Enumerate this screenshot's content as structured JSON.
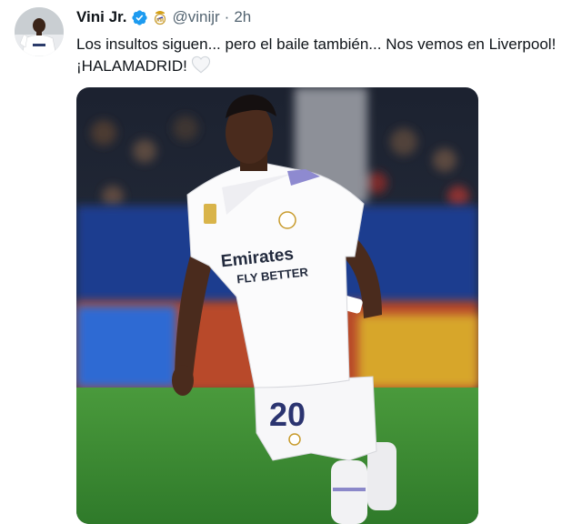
{
  "author": {
    "name": "Vini Jr.",
    "handle": "@vinijr",
    "time": "2h",
    "verified_color": "#1d9bf0",
    "avatar_icon": "player-avatar-icon",
    "badge_icon": "real-madrid-crest-icon"
  },
  "tweet": {
    "line1": "Los insultos siguen... pero el baile también... Nos vemos en Liverpool!",
    "line2": "¡HALAMADRID!",
    "emoji": "white-heart-icon"
  },
  "media": {
    "shirt_sponsor_top": "Emirates",
    "shirt_sponsor_bottom": "FLY BETTER",
    "shorts_number": "20"
  },
  "colors": {
    "text": "#0f1419",
    "muted": "#536471",
    "pitch": "#3f8a34"
  }
}
